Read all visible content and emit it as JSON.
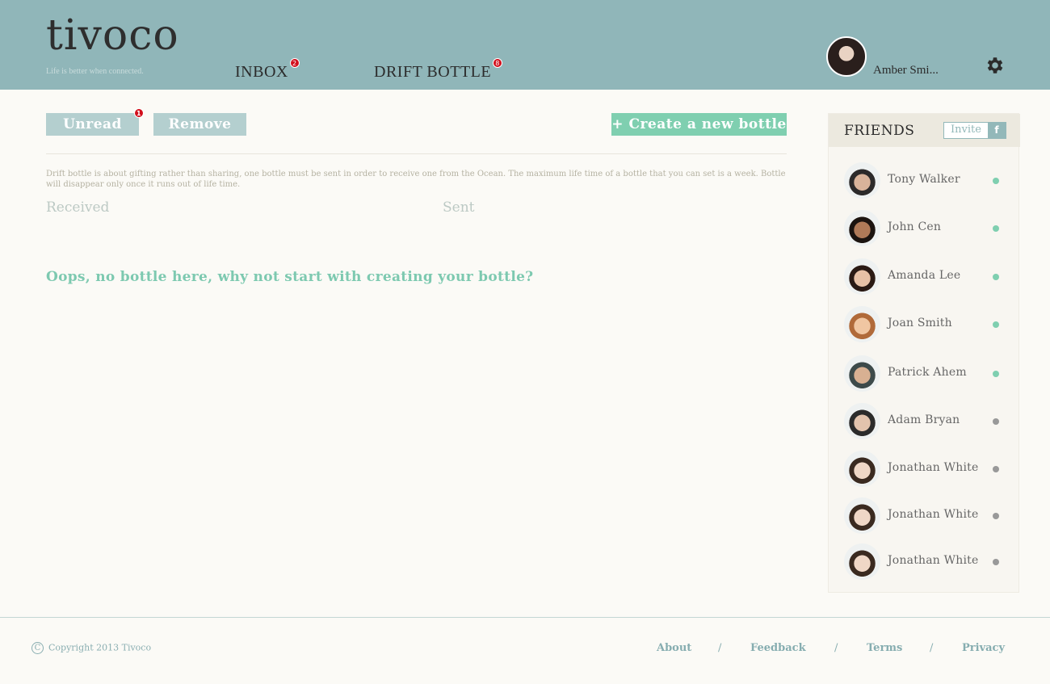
{
  "header": {
    "logo": "tivoco",
    "tagline": "Life is better when connected.",
    "nav": [
      {
        "label": "INBOX",
        "badge": "2"
      },
      {
        "label": "DRIFT BOTTLE",
        "badge": "8"
      }
    ],
    "user_name": "Amber Smi...",
    "settings_icon": "gear-icon"
  },
  "toolbar": {
    "unread_label": "Unread",
    "unread_badge": "1",
    "remove_label": "Remove",
    "create_label": "+ Create a new bottle"
  },
  "main": {
    "description": "Drift bottle is about gifting rather than sharing, one bottle must be sent in order to receive one from the Ocean. The maximum life time of a bottle that you can set is a week. Bottle will disappear only once it runs out of life time.",
    "received_label": "Received",
    "sent_label": "Sent",
    "empty_message": "Oops, no bottle here, why not start with creating your bottle?"
  },
  "friends": {
    "title": "FRIENDS",
    "invite_label": "Invite",
    "fb_letter": "f",
    "online_color": "#7fcfb0",
    "offline_color": "#999999",
    "items": [
      {
        "name": "Tony Walker",
        "online": true
      },
      {
        "name": "John Cen",
        "online": true
      },
      {
        "name": "Amanda Lee",
        "online": true
      },
      {
        "name": "Joan Smith",
        "online": true
      },
      {
        "name": "Patrick Ahem",
        "online": true
      },
      {
        "name": "Adam Bryan",
        "online": false
      },
      {
        "name": "Jonathan White",
        "online": false
      },
      {
        "name": "Jonathan White",
        "online": false
      },
      {
        "name": "Jonathan White",
        "online": false
      }
    ]
  },
  "footer": {
    "copyright_symbol": "C",
    "copyright": "Copyright 2013 Tivoco",
    "links": [
      "About",
      "Feedback",
      "Terms",
      "Privacy"
    ],
    "separator": "/"
  },
  "colors": {
    "header_bg": "#90b6b9",
    "accent_green": "#7fcfb0",
    "button_gray": "#b4cfcf",
    "badge_red": "#d20f1c"
  }
}
